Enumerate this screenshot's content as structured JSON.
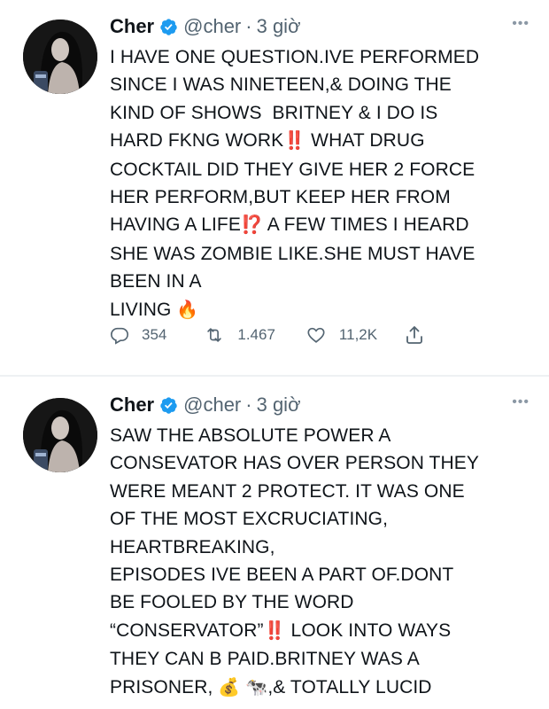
{
  "tweets": [
    {
      "name": "Cher",
      "handle": "@cher",
      "separator": "·",
      "time": "3 giờ",
      "more": "•••",
      "lines": [
        [
          "I HAVE ONE QUESTION.IVE PERFORMED"
        ],
        [
          "SINCE I WAS NINETEEN,& DOING THE"
        ],
        [
          "KIND OF SHOWS  BRITNEY & I DO IS"
        ],
        [
          "HARD FKNG WORK",
          "‼️",
          " WHAT DRUG"
        ],
        [
          "COCKTAIL DID THEY GIVE HER 2 FORCE"
        ],
        [
          "HER PERFORM,BUT KEEP HER FROM"
        ],
        [
          "HAVING A LIFE",
          "⁉️",
          " A FEW TIMES I HEARD"
        ],
        [
          "SHE WAS ZOMBIE LIKE.SHE MUST HAVE"
        ],
        [
          "BEEN IN A"
        ],
        [
          "LIVING ",
          "🔥"
        ]
      ],
      "replies": "354",
      "retweets": "1.467",
      "likes": "11,2K"
    },
    {
      "name": "Cher",
      "handle": "@cher",
      "separator": "·",
      "time": "3 giờ",
      "more": "•••",
      "lines": [
        [
          "SAW THE ABSOLUTE POWER A"
        ],
        [
          "CONSEVATOR HAS OVER PERSON THEY"
        ],
        [
          "WERE MEANT 2 PROTECT. IT WAS ONE"
        ],
        [
          "OF THE MOST EXCRUCIATING,"
        ],
        [
          "HEARTBREAKING,"
        ],
        [
          "EPISODES IVE BEEN A PART OF.DONT"
        ],
        [
          "BE FOOLED BY THE WORD"
        ],
        [
          "“CONSERVATOR”",
          "‼️",
          " LOOK INTO WAYS"
        ],
        [
          "THEY CAN B PAID.BRITNEY WAS A"
        ],
        [
          "PRISONER, ",
          "💰",
          " ",
          "🐄",
          ",& TOTALLY LUCID"
        ]
      ]
    }
  ],
  "colors": {
    "verified_blue": "#1d9bf0",
    "handle_gray": "#536471",
    "emoji_red": "#e0242b",
    "divider": "#eef1f3"
  },
  "icons": {
    "reply": "reply-icon",
    "retweet": "retweet-icon",
    "like": "heart-icon",
    "share": "share-icon",
    "verified": "verified-badge-icon",
    "more": "more-options-icon"
  }
}
